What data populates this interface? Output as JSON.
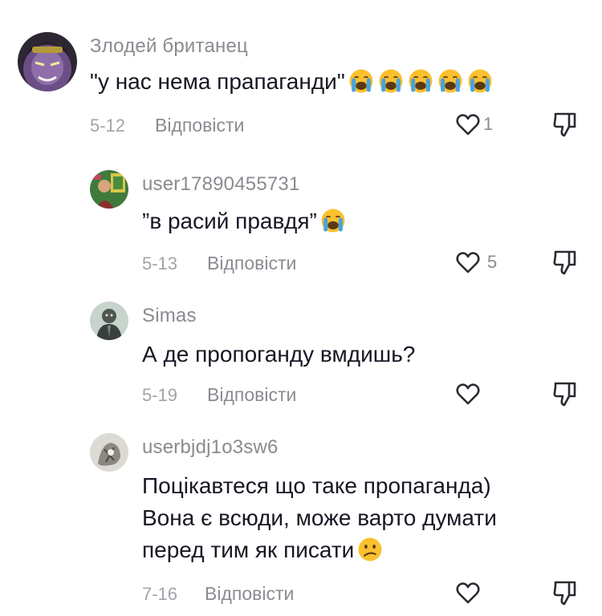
{
  "comments": [
    {
      "username": "Злодей британец",
      "text": "\"у нас нема прапаганди\"",
      "emoji": "loudly-crying-face-emoji",
      "emoji_count": 5,
      "date": "5-12",
      "reply_label": "Відповісти",
      "likes": "1"
    },
    {
      "username": "user17890455731",
      "text": "”в расий правдя”",
      "emoji": "loudly-crying-face-emoji",
      "emoji_count": 1,
      "date": "5-13",
      "reply_label": "Відповісти",
      "likes": "5"
    },
    {
      "username": "Simas",
      "text": "А де пропоганду вмдишь?",
      "date": "5-19",
      "reply_label": "Відповісти",
      "likes": ""
    },
    {
      "username": "userbjdj1o3sw6",
      "lines": [
        "Поцікавтеся що таке пропаганда)",
        "Вона є всюди, може варто думати",
        "перед тим як писати"
      ],
      "emoji": "confused-face-emoji",
      "date": "7-16",
      "reply_label": "Відповісти",
      "likes": ""
    }
  ],
  "icons": {
    "like": "heart-outline-icon",
    "dislike": "thumbs-down-icon"
  },
  "colors": {
    "text": "#161823",
    "secondary": "#8a8b91",
    "date": "#a3a4a9",
    "emoji_yellow": "#fbc02d",
    "emoji_tears": "#4aa3df"
  }
}
